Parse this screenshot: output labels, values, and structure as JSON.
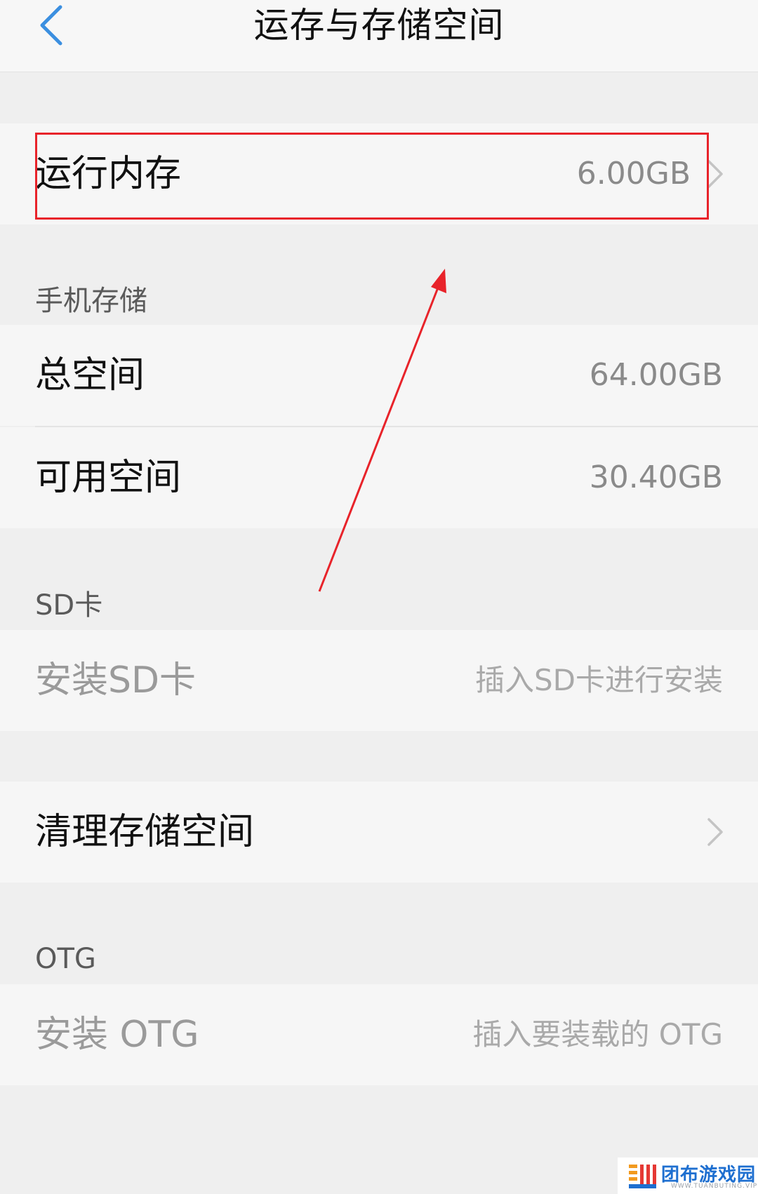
{
  "header": {
    "title": "运存与存储空间"
  },
  "ram": {
    "label": "运行内存",
    "value": "6.00GB"
  },
  "phone_storage": {
    "section_title": "手机存储",
    "total_label": "总空间",
    "total_value": "64.00GB",
    "available_label": "可用空间",
    "available_value": "30.40GB"
  },
  "sd_card": {
    "section_title": "SD卡",
    "install_label": "安装SD卡",
    "install_hint": "插入SD卡进行安装"
  },
  "cleanup": {
    "label": "清理存储空间"
  },
  "otg": {
    "section_title": "OTG",
    "install_label": "安装 OTG",
    "install_hint": "插入要装载的 OTG"
  },
  "watermark": {
    "name": "团布游戏园",
    "url": "WWW.TUANBUTING.VIP"
  },
  "colors": {
    "annotation": "#e8232a",
    "accent": "#3b8fe0",
    "watermark": "#1e6fd0"
  }
}
